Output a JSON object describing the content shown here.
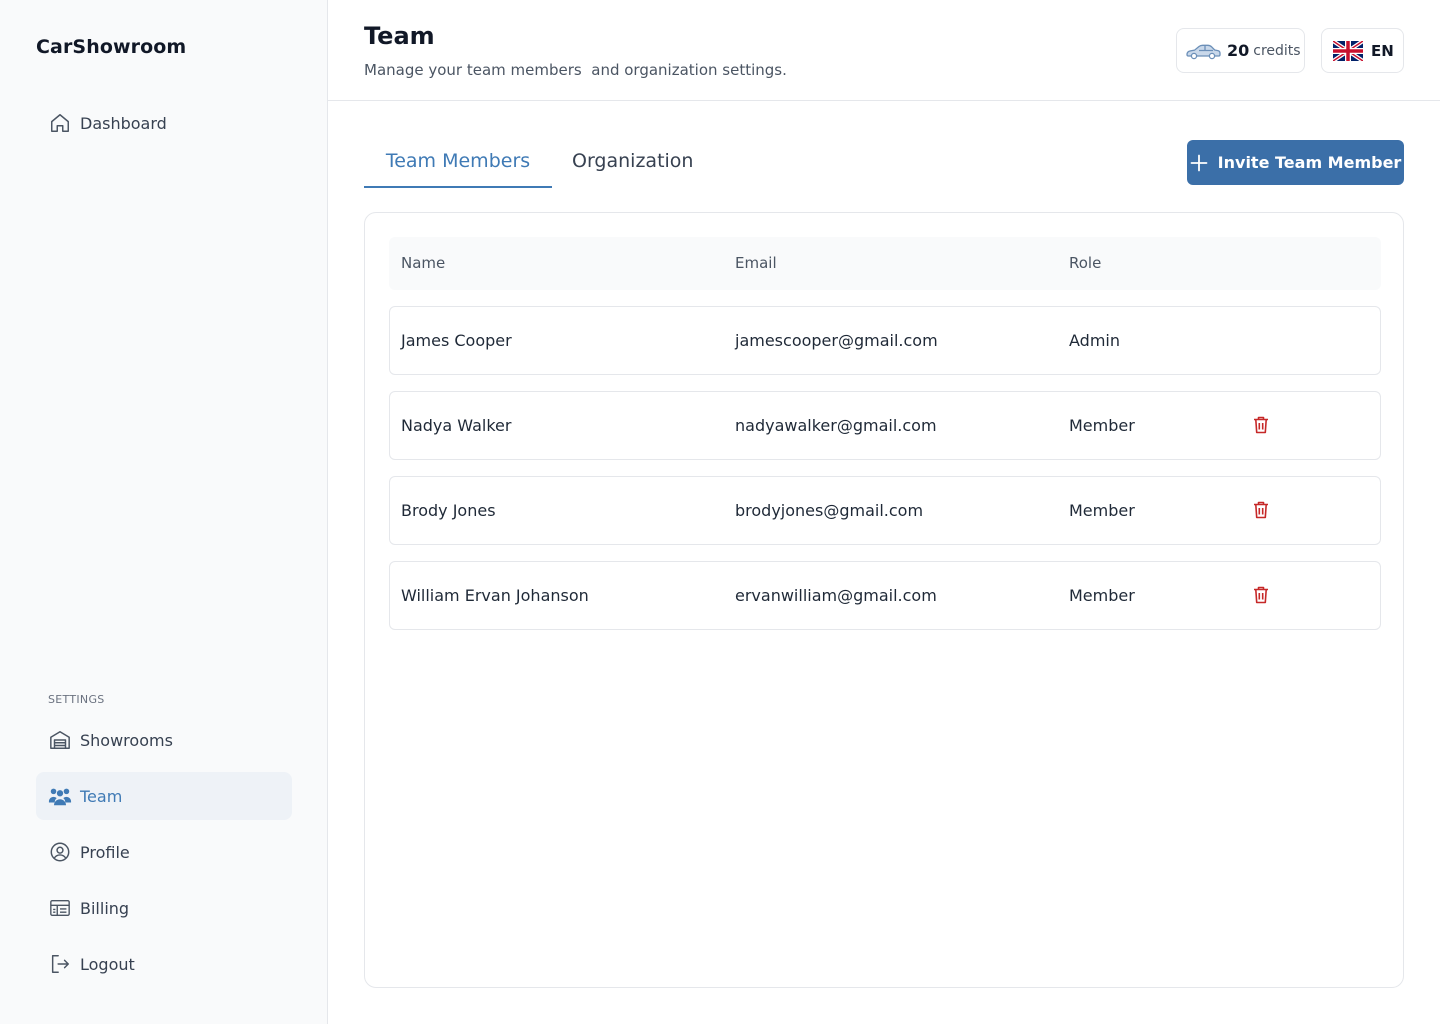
{
  "app": {
    "brand": "CarShowroom"
  },
  "sidebar": {
    "main_items": [
      {
        "label": "Dashboard",
        "icon": "home-icon"
      }
    ],
    "settings_label": "SETTINGS",
    "settings_items": [
      {
        "label": "Showrooms",
        "icon": "garage-icon"
      },
      {
        "label": "Team",
        "icon": "team-icon",
        "active": true
      },
      {
        "label": "Profile",
        "icon": "user-circle-icon"
      },
      {
        "label": "Billing",
        "icon": "billing-icon"
      },
      {
        "label": "Logout",
        "icon": "logout-icon"
      }
    ]
  },
  "header": {
    "title": "Team",
    "subtitle": "Manage your team members  and organization settings.",
    "credits": {
      "value": "20",
      "unit": "credits",
      "icon": "car-icon"
    },
    "language": {
      "code": "EN",
      "icon": "uk-flag-icon"
    }
  },
  "tabs": [
    {
      "label": "Team Members",
      "active": true
    },
    {
      "label": "Organization",
      "active": false
    }
  ],
  "invite_button": {
    "label": "Invite Team Member",
    "icon": "plus-icon"
  },
  "table": {
    "columns": [
      "Name",
      "Email",
      "Role"
    ],
    "rows": [
      {
        "name": "James Cooper",
        "email": "jamescooper@gmail.com",
        "role": "Admin",
        "deletable": false
      },
      {
        "name": "Nadya Walker",
        "email": "nadyawalker@gmail.com",
        "role": "Member",
        "deletable": true
      },
      {
        "name": "Brody Jones",
        "email": "brodyjones@gmail.com",
        "role": "Member",
        "deletable": true
      },
      {
        "name": "William Ervan Johanson",
        "email": "ervanwilliam@gmail.com",
        "role": "Member",
        "deletable": true
      }
    ]
  },
  "colors": {
    "accent": "#3f7ab5",
    "button": "#3b6fa8",
    "danger": "#c62828",
    "active_bg": "#eef2f7"
  }
}
